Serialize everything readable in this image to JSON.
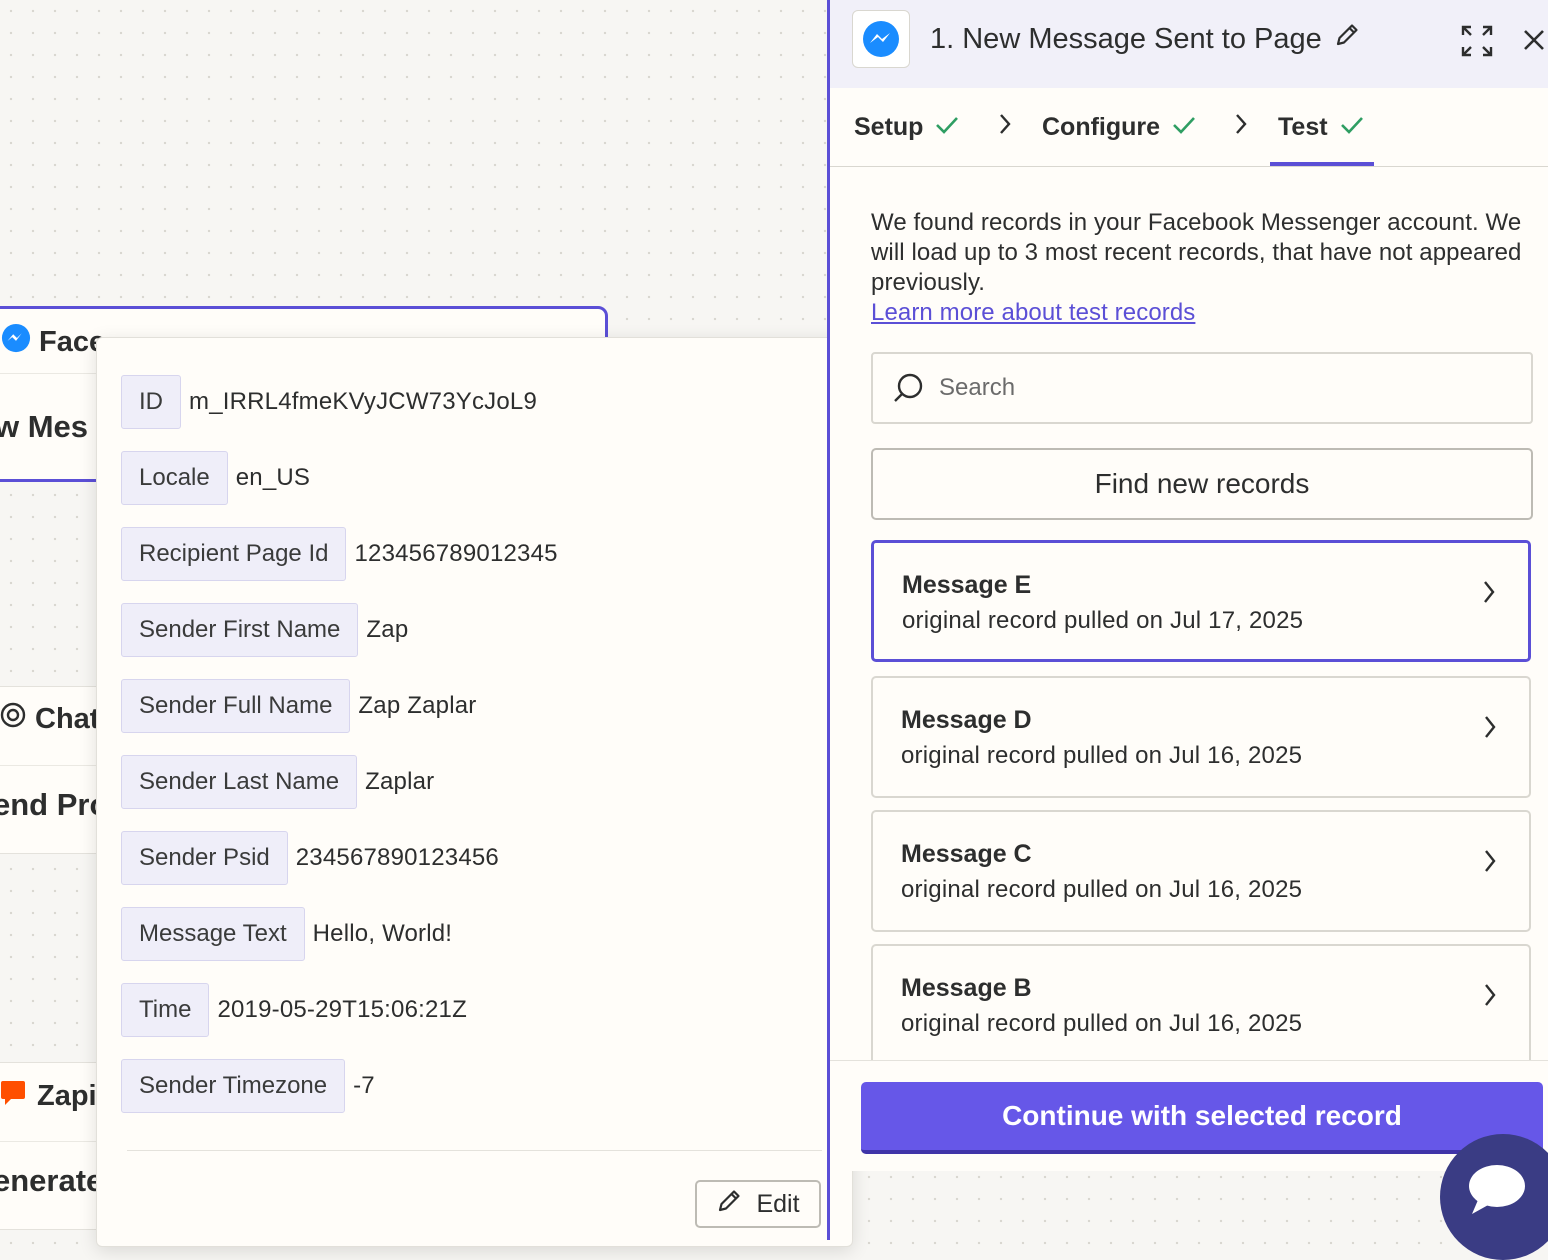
{
  "canvas": {
    "nodes": [
      {
        "app": "Face",
        "step": "w Mes",
        "selected": true
      },
      {
        "app": "Chat",
        "step": "end Pro",
        "selected": false
      },
      {
        "app": "Zapi",
        "step": "enerate",
        "selected": false
      }
    ]
  },
  "record_detail": {
    "fields": [
      {
        "key": "ID",
        "value": "m_IRRL4fmeKVyJCW73YcJoL9"
      },
      {
        "key": "Locale",
        "value": "en_US"
      },
      {
        "key": "Recipient Page Id",
        "value": "123456789012345"
      },
      {
        "key": "Sender First Name",
        "value": "Zap"
      },
      {
        "key": "Sender Full Name",
        "value": "Zap Zaplar"
      },
      {
        "key": "Sender Last Name",
        "value": "Zaplar"
      },
      {
        "key": "Sender Psid",
        "value": "234567890123456"
      },
      {
        "key": "Message Text",
        "value": "Hello, World!"
      },
      {
        "key": "Time",
        "value": "2019-05-29T15:06:21Z"
      },
      {
        "key": "Sender Timezone",
        "value": "-7"
      }
    ],
    "edit_label": "Edit"
  },
  "panel": {
    "title": "1. New Message Sent to Page",
    "app_icon": "messenger-icon",
    "tabs": [
      {
        "label": "Setup",
        "done": true
      },
      {
        "label": "Configure",
        "done": true
      },
      {
        "label": "Test",
        "done": true,
        "active": true
      }
    ],
    "intro": "We found records in your Facebook Messenger account. We will load up to 3 most recent records, that have not appeared previously.",
    "learn_more": "Learn more about test records",
    "search_placeholder": "Search",
    "find_button": "Find new records",
    "records": [
      {
        "name": "Message E",
        "subtitle": "original record pulled on Jul 17, 2025",
        "selected": true
      },
      {
        "name": "Message D",
        "subtitle": "original record pulled on Jul 16, 2025",
        "selected": false
      },
      {
        "name": "Message C",
        "subtitle": "original record pulled on Jul 16, 2025",
        "selected": false
      },
      {
        "name": "Message B",
        "subtitle": "original record pulled on Jul 16, 2025",
        "selected": false
      }
    ],
    "continue_button": "Continue with selected record"
  },
  "colors": {
    "accent": "#5b4fd6",
    "button": "#6657e8",
    "chat": "#3a3c84"
  }
}
